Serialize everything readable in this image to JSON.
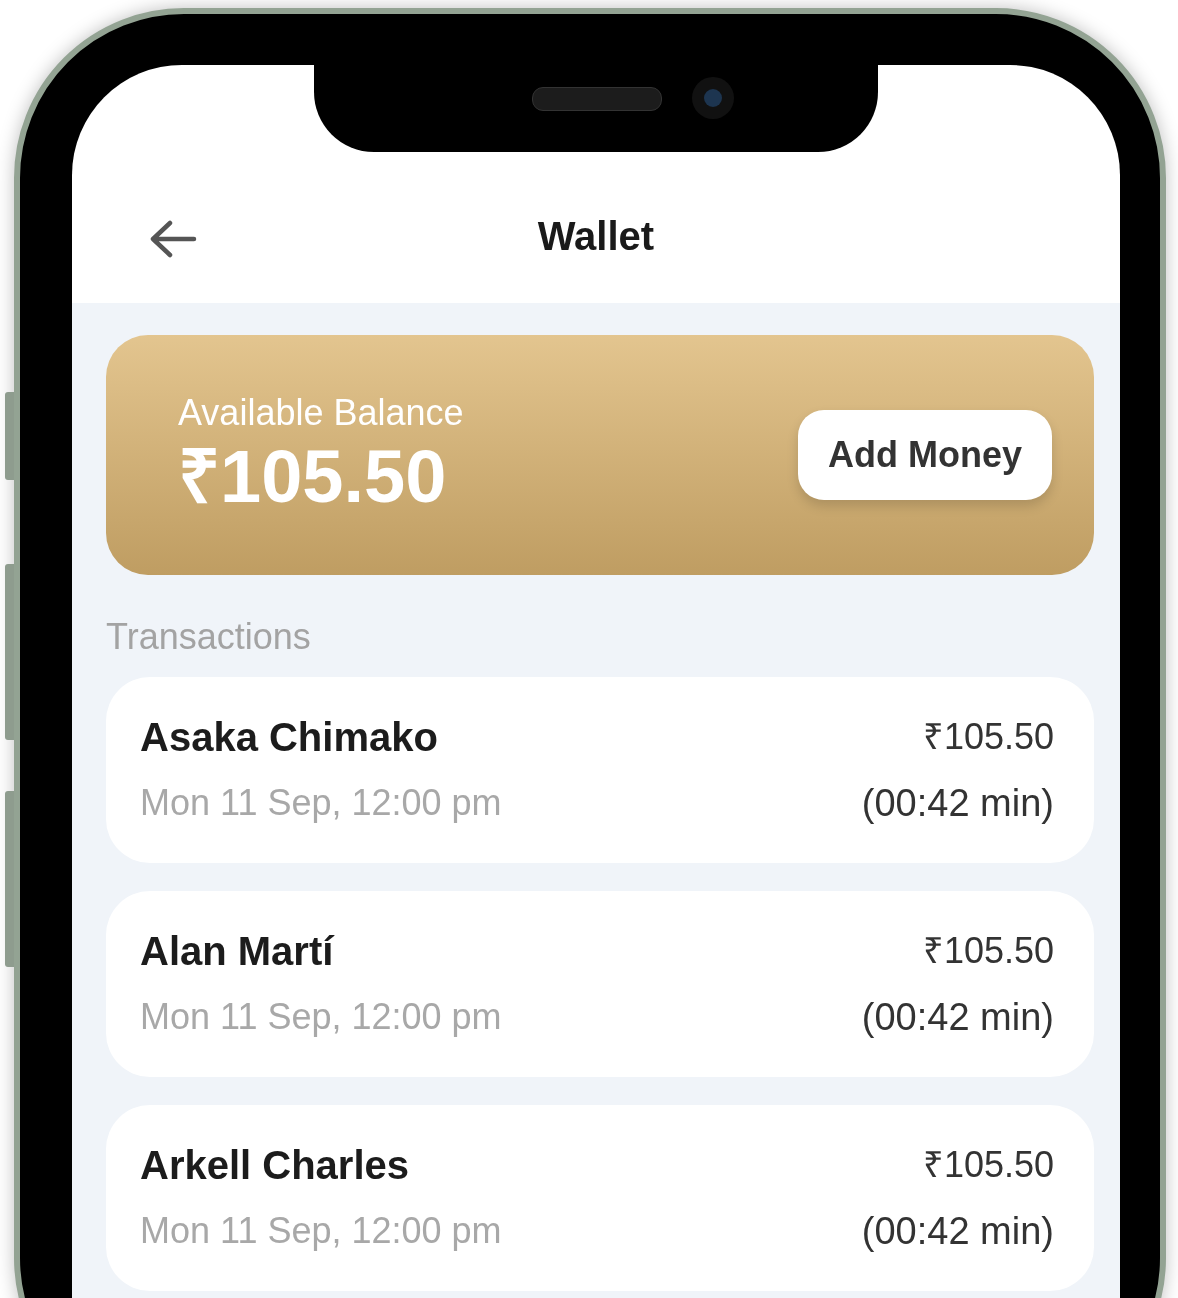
{
  "header": {
    "title": "Wallet"
  },
  "balance": {
    "label": "Available Balance",
    "amount": "₹105.50",
    "button": "Add Money"
  },
  "transactions": {
    "title": "Transactions",
    "items": [
      {
        "name": "Asaka Chimako",
        "date": "Mon 11 Sep, 12:00 pm",
        "amount": "₹105.50",
        "duration": "(00:42 min)"
      },
      {
        "name": "Alan Martí",
        "date": "Mon 11 Sep, 12:00 pm",
        "amount": "₹105.50",
        "duration": "(00:42 min)"
      },
      {
        "name": "Arkell Charles",
        "date": "Mon 11 Sep, 12:00 pm",
        "amount": "₹105.50",
        "duration": "(00:42 min)"
      }
    ]
  }
}
